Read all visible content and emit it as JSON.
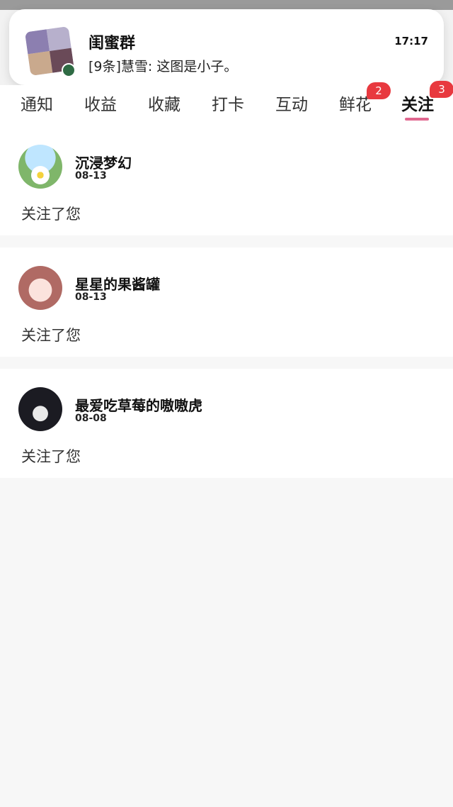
{
  "notification": {
    "title": "闺蜜群",
    "time": "17:17",
    "message": "[9条]慧雪: 这图是小子。"
  },
  "tabs": [
    {
      "label": "通知",
      "active": false
    },
    {
      "label": "收益",
      "active": false
    },
    {
      "label": "收藏",
      "active": false
    },
    {
      "label": "打卡",
      "active": false
    },
    {
      "label": "互动",
      "active": false
    },
    {
      "label": "鲜花",
      "active": false,
      "badge": "2"
    },
    {
      "label": "关注",
      "active": true,
      "badge": "3"
    }
  ],
  "follows": [
    {
      "name": "沉浸梦幻",
      "date": "08-13",
      "action": "关注了您"
    },
    {
      "name": "星星的果酱罐",
      "date": "08-13",
      "action": "关注了您"
    },
    {
      "name": "最爱吃草莓的嗷嗷虎",
      "date": "08-08",
      "action": "关注了您"
    }
  ],
  "colors": {
    "accent": "#e0678f",
    "badge": "#e8393f"
  }
}
